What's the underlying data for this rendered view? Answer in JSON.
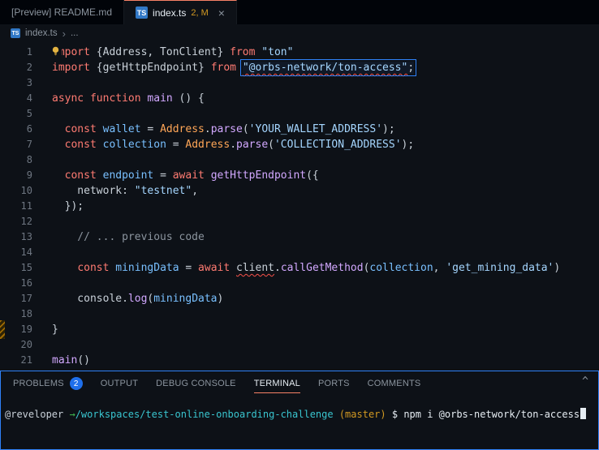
{
  "tab_bar": {
    "preview_tab": {
      "label": "[Preview] README.md"
    },
    "active_tab": {
      "icon": "TS",
      "label": "index.ts",
      "decoration": "2, M",
      "close_icon": "×"
    }
  },
  "breadcrumb": {
    "file_icon": "TS",
    "file_name": "index.ts",
    "separator": "›",
    "ellipsis": "..."
  },
  "editor": {
    "lines": [
      {
        "n": 1,
        "t": [
          [
            "k",
            "import"
          ],
          [
            "p",
            " {Address, TonClient} "
          ],
          [
            "k",
            "from"
          ],
          [
            "p",
            " "
          ],
          [
            "s",
            "\"ton\""
          ]
        ]
      },
      {
        "n": 2,
        "t": [
          [
            "k",
            "import"
          ],
          [
            "p",
            " {getHttpEndpoint} "
          ],
          [
            "k",
            "from"
          ],
          [
            "p",
            " "
          ],
          [
            "box",
            [
              [
                "s sq",
                "\"@orbs-network/ton-access\""
              ],
              [
                "p",
                ";"
              ]
            ]
          ]
        ]
      },
      {
        "n": 3,
        "t": []
      },
      {
        "n": 4,
        "t": [
          [
            "k",
            "async"
          ],
          [
            "p",
            " "
          ],
          [
            "k",
            "function"
          ],
          [
            "p",
            " "
          ],
          [
            "fn",
            "main"
          ],
          [
            "p",
            " () {"
          ]
        ]
      },
      {
        "n": 5,
        "t": []
      },
      {
        "n": 6,
        "t": [
          [
            "p",
            "  "
          ],
          [
            "k",
            "const"
          ],
          [
            "p",
            " "
          ],
          [
            "v",
            "wallet"
          ],
          [
            "p",
            " = "
          ],
          [
            "cls",
            "Address"
          ],
          [
            "p",
            "."
          ],
          [
            "fn",
            "parse"
          ],
          [
            "p",
            "("
          ],
          [
            "s",
            "'YOUR_WALLET_ADDRESS'"
          ],
          [
            "p",
            ");"
          ]
        ]
      },
      {
        "n": 7,
        "t": [
          [
            "p",
            "  "
          ],
          [
            "k",
            "const"
          ],
          [
            "p",
            " "
          ],
          [
            "v",
            "collection"
          ],
          [
            "p",
            " = "
          ],
          [
            "cls",
            "Address"
          ],
          [
            "p",
            "."
          ],
          [
            "fn",
            "parse"
          ],
          [
            "p",
            "("
          ],
          [
            "s",
            "'COLLECTION_ADDRESS'"
          ],
          [
            "p",
            ");"
          ]
        ]
      },
      {
        "n": 8,
        "t": []
      },
      {
        "n": 9,
        "t": [
          [
            "p",
            "  "
          ],
          [
            "k",
            "const"
          ],
          [
            "p",
            " "
          ],
          [
            "v",
            "endpoint"
          ],
          [
            "p",
            " = "
          ],
          [
            "k",
            "await"
          ],
          [
            "p",
            " "
          ],
          [
            "fn",
            "getHttpEndpoint"
          ],
          [
            "p",
            "({"
          ]
        ]
      },
      {
        "n": 10,
        "t": [
          [
            "p",
            "    network: "
          ],
          [
            "s",
            "\"testnet\""
          ],
          [
            "p",
            ","
          ]
        ]
      },
      {
        "n": 11,
        "t": [
          [
            "p",
            "  });"
          ]
        ]
      },
      {
        "n": 12,
        "t": []
      },
      {
        "n": 13,
        "t": [
          [
            "c",
            "    // ... previous code"
          ]
        ]
      },
      {
        "n": 14,
        "t": []
      },
      {
        "n": 15,
        "t": [
          [
            "p",
            "    "
          ],
          [
            "k",
            "const"
          ],
          [
            "p",
            " "
          ],
          [
            "v",
            "miningData"
          ],
          [
            "p",
            " = "
          ],
          [
            "k",
            "await"
          ],
          [
            "p",
            " "
          ],
          [
            "p sq",
            "client"
          ],
          [
            "p",
            "."
          ],
          [
            "fn",
            "callGetMethod"
          ],
          [
            "p",
            "("
          ],
          [
            "v",
            "collection"
          ],
          [
            "p",
            ", "
          ],
          [
            "s",
            "'get_mining_data'"
          ],
          [
            "p",
            ")"
          ]
        ]
      },
      {
        "n": 16,
        "t": []
      },
      {
        "n": 17,
        "t": [
          [
            "p",
            "    console."
          ],
          [
            "fn",
            "log"
          ],
          [
            "p",
            "("
          ],
          [
            "v",
            "miningData"
          ],
          [
            "p",
            ")"
          ]
        ]
      },
      {
        "n": 18,
        "t": []
      },
      {
        "n": 19,
        "t": [
          [
            "p",
            "}"
          ]
        ]
      },
      {
        "n": 20,
        "t": []
      },
      {
        "n": 21,
        "t": [
          [
            "fn",
            "main"
          ],
          [
            "p",
            "()"
          ]
        ]
      }
    ]
  },
  "panel": {
    "tabs": [
      {
        "label": "PROBLEMS",
        "badge": "2",
        "active": false
      },
      {
        "label": "OUTPUT",
        "active": false
      },
      {
        "label": "DEBUG CONSOLE",
        "active": false
      },
      {
        "label": "TERMINAL",
        "active": true
      },
      {
        "label": "PORTS",
        "active": false
      },
      {
        "label": "COMMENTS",
        "active": false
      }
    ],
    "actions": {
      "collapse": "^"
    },
    "terminal": {
      "user": "@reveloper",
      "arrow": " →",
      "path": "/workspaces/test-online-onboarding-challenge",
      "branch": " (master)",
      "prompt_symbol": " $ ",
      "command": "npm i @orbs-network/ton-access"
    }
  },
  "colors": {
    "focus_border": "#2f81f7",
    "badge": "#1f6feb",
    "selection_box": "#2f81f7",
    "modified_decoration": "#d29922"
  }
}
